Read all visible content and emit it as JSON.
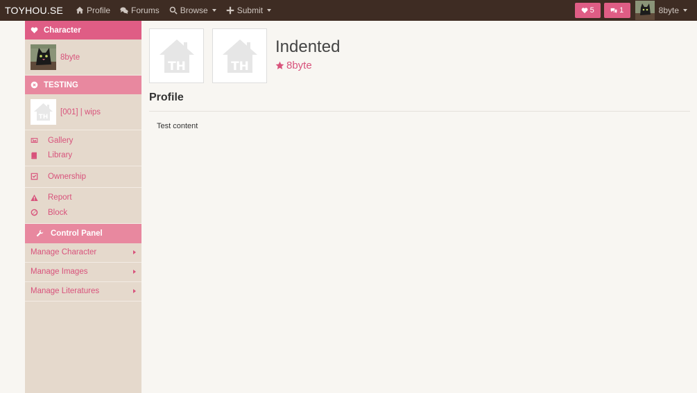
{
  "navbar": {
    "brand": "TOYHOU.SE",
    "items": [
      {
        "label": "Profile",
        "icon": "home-icon"
      },
      {
        "label": "Forums",
        "icon": "comments-icon"
      },
      {
        "label": "Browse",
        "icon": "search-icon"
      },
      {
        "label": "Submit",
        "icon": "plus-icon"
      }
    ],
    "favorites_count": "5",
    "messages_count": "1",
    "username": "8byte"
  },
  "sidebar": {
    "character_header": "Character",
    "character_name": "8byte",
    "folder_header": "TESTING",
    "folder_item": "[001] | wips",
    "links": {
      "gallery": "Gallery",
      "library": "Library",
      "ownership": "Ownership",
      "report": "Report",
      "block": "Block"
    },
    "control_panel_header": "Control Panel",
    "menus": {
      "manage_character": "Manage Character",
      "manage_images": "Manage Images",
      "manage_literatures": "Manage Literatures"
    }
  },
  "main": {
    "character_name": "Indented",
    "owner": "8byte",
    "placeholder_text": "TH",
    "section_title": "Profile",
    "content": "Test content"
  },
  "colors": {
    "navbar_bg": "#3e2c23",
    "accent": "#df5d85",
    "sidebar_bg": "#e5d9cc",
    "page_bg": "#f8f6f2"
  }
}
